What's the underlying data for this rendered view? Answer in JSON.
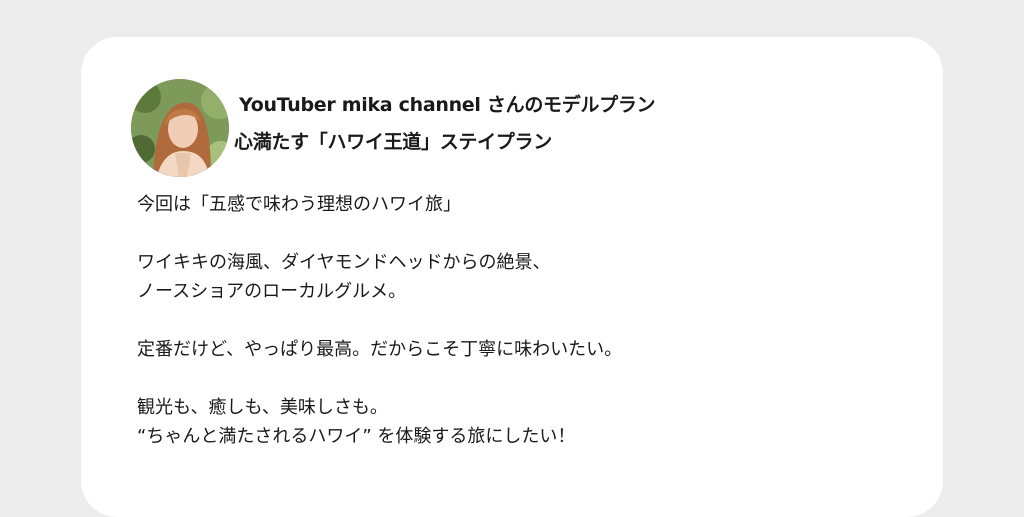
{
  "card": {
    "title": "YouTuber mika channel さんのモデルプラン",
    "subtitle": "心満たす「ハワイ王道」ステイプラン"
  },
  "paragraphs": [
    {
      "lines": [
        "今回は「五感で味わう理想のハワイ旅」"
      ]
    },
    {
      "lines": [
        "ワイキキの海風、ダイヤモンドヘッドからの絶景、",
        "ノースショアのローカルグルメ。"
      ]
    },
    {
      "lines": [
        "定番だけど、やっぱり最高。だからこそ丁寧に味わいたい。"
      ]
    },
    {
      "lines": [
        "観光も、癒しも、美味しさも。",
        "“ちゃんと満たされるハワイ” を体験する旅にしたい！"
      ]
    }
  ],
  "colors": {
    "page_background": "#ececec",
    "card_background": "#ffffff",
    "text": "#1a1a1a"
  }
}
